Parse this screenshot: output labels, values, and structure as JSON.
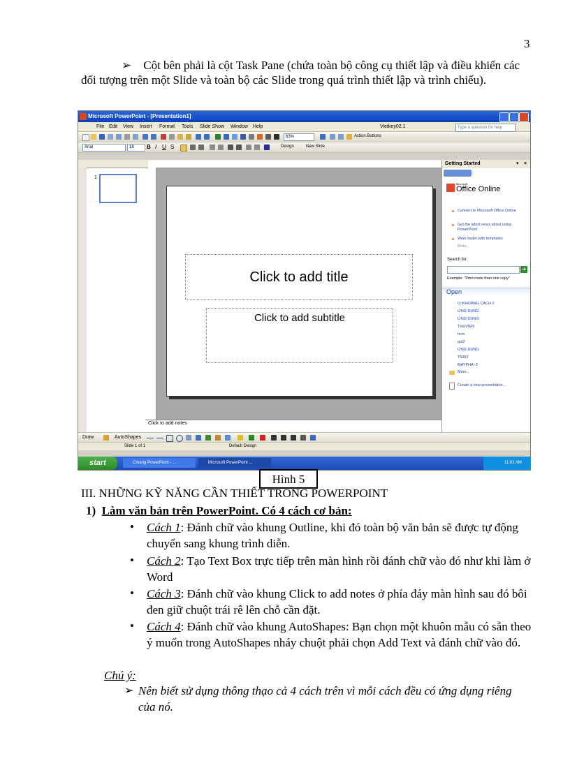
{
  "page": {
    "number": "3",
    "intro_arrow": "➢",
    "intro_text": "Cột bên phải là cột Task Pane (chứa toàn bộ công cụ thiết lập và điều khiển các đối tượng trên một Slide và toàn bộ các Slide trong quá trình thiết lập và trình chiếu)."
  },
  "screenshot": {
    "window_title": "Microsoft PowerPoint - [Presentation1]",
    "menu": [
      "File",
      "Edit",
      "View",
      "Insert",
      "Format",
      "Tools",
      "Slide Show",
      "Window",
      "Help"
    ],
    "vietkey": "Vietkey02.1",
    "ask_placeholder": "Type a question for help",
    "zoom": "63%",
    "action_buttons": "Action Buttons",
    "font_name": "Arial",
    "font_size": "18",
    "design_label": "Design",
    "new_slide_label": "New Slide",
    "slide_number": "1",
    "title_placeholder": "Click to add title",
    "subtitle_placeholder": "Click to add subtitle",
    "notes_placeholder": "Click to add notes",
    "task_pane": {
      "title": "Getting Started",
      "brand_small": "Microsoft",
      "brand": "Office Online",
      "links": [
        "Connect to Microsoft Office Online",
        "Get the latest news about using PowerPoint",
        "Work faster with templates"
      ],
      "more": "More...",
      "search_label": "Search for:",
      "example": "Example: \"Print more than one copy\"",
      "open_heading": "Open",
      "files": [
        "D:\\KHOẢNG CÁCH 2",
        "ỨNG DỤNG",
        "ỨNG DỤNG",
        "THUVIEN",
        "hcm",
        "ppt2",
        "ỨNG DỤNG",
        "TNAO",
        "MAYPHA~2"
      ],
      "files_more": "More...",
      "create_new": "Create a new presentation..."
    },
    "draw_label": "Draw",
    "autoshapes_label": "AutoShapes",
    "status_slide": "Slide 1 of 1",
    "status_design": "Default Design",
    "taskbar": {
      "start": "start",
      "items": [
        "Cmang PowerPoint - ...",
        "Microsoft PowerPoint ..."
      ],
      "clock": "11:01 AM"
    }
  },
  "figure_caption": "Hình 5",
  "section": {
    "heading": "III. NHỮNG KỸ NĂNG CẦN THIẾT TRONG POWERPOINT",
    "sub_number": "1)",
    "sub_heading": "Làm văn bản trên PowerPoint. Có 4 cách cơ bản:",
    "bullet_symbol": "•",
    "items": [
      {
        "label": "Cách 1",
        "text": ":   Đánh chữ vào khung Outline, khi đó toàn bộ văn bản sẽ được tự động chuyển sang khung trình diễn."
      },
      {
        "label": "Cách 2",
        "text": ":   Tạo Text Box trực tiếp trên màn hình rồi đánh chữ vào đó như khi làm ở Word"
      },
      {
        "label": "Cách 3",
        "text": ":   Đánh chữ vào khung Click to add notes ở phía đáy màn hình sau đó bôi đen giữ chuột trái rê lên chỗ cần đặt."
      },
      {
        "label": "Cách 4",
        "text": ":   Đánh chữ vào khung AutoShapes: Bạn chọn một khuôn mẫu có sẵn theo ý muốn trong AutoShapes nháy chuột phải chọn Add Text và đánh chữ vào đó."
      }
    ],
    "note_label": "Chú ý:",
    "note_arrow": "➢",
    "note_text": "Nên biết sử dụng thông thạo cả 4 cách trên vì mỗi cách đều có ứng dụng riêng của nó."
  }
}
